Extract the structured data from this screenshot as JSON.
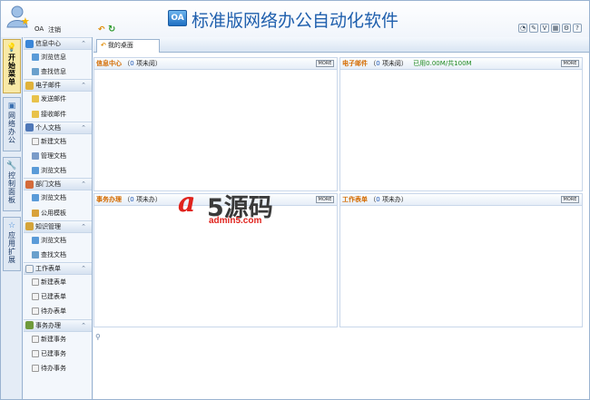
{
  "header": {
    "user_name": "OA",
    "logout": "注销",
    "logo_badge": "OA",
    "app_title": "标准版网络办公自动化软件",
    "tool_icons": [
      "chat-icon",
      "note-icon",
      "v-icon",
      "calendar-icon",
      "settings-icon",
      "help-icon"
    ],
    "tool_glyphs": [
      "◔",
      "✎",
      "V",
      "▦",
      "⚙",
      "?"
    ]
  },
  "vnav": [
    {
      "icon": "lightbulb-icon",
      "label": "开始菜单",
      "active": true
    },
    {
      "icon": "network-icon",
      "label": "网络办公",
      "active": false
    },
    {
      "icon": "wrench-icon",
      "label": "控制面板",
      "active": false
    },
    {
      "icon": "star-icon",
      "label": "应用扩展",
      "active": false
    }
  ],
  "sidebar": {
    "groups": [
      {
        "label": "信息中心",
        "icon_color": "#3a86d8",
        "items": [
          "浏览信息",
          "查找信息"
        ]
      },
      {
        "label": "电子邮件",
        "icon_color": "#e0b23a",
        "items": [
          "发送邮件",
          "接收邮件"
        ]
      },
      {
        "label": "个人文档",
        "icon_color": "#4f78b8",
        "items": [
          "新建文档",
          "管理文档",
          "浏览文档"
        ]
      },
      {
        "label": "部门文档",
        "icon_color": "#d46b3a",
        "items": [
          "浏览文档",
          "公用模板"
        ]
      },
      {
        "label": "知识管理",
        "icon_color": "#d4a43a",
        "items": [
          "浏览文档",
          "查找文档"
        ]
      },
      {
        "label": "工作表单",
        "icon_color": "#8aa0b8",
        "items": [
          "新建表单",
          "已建表单",
          "待办表单"
        ]
      },
      {
        "label": "事务办理",
        "icon_color": "#6f9a3a",
        "items": [
          "新建事务",
          "已建事务",
          "待办事务"
        ]
      }
    ]
  },
  "main": {
    "tab_label": "我的桌面",
    "more_label": "MORE",
    "panels": {
      "info": {
        "title": "信息中心",
        "count": "0",
        "suffix": "项未阅）"
      },
      "mail": {
        "title": "电子邮件",
        "count": "0",
        "suffix": "项未阅）",
        "used": "已用0.00M/共100M"
      },
      "affairs": {
        "title": "事务办理",
        "count": "0",
        "suffix": "项未办）"
      },
      "forms": {
        "title": "工作表单",
        "count": "0",
        "suffix": "项未办）"
      }
    },
    "paren_open": "（"
  },
  "watermark": {
    "a": "a",
    "brand": "5源码",
    "url": "admin5.com"
  }
}
